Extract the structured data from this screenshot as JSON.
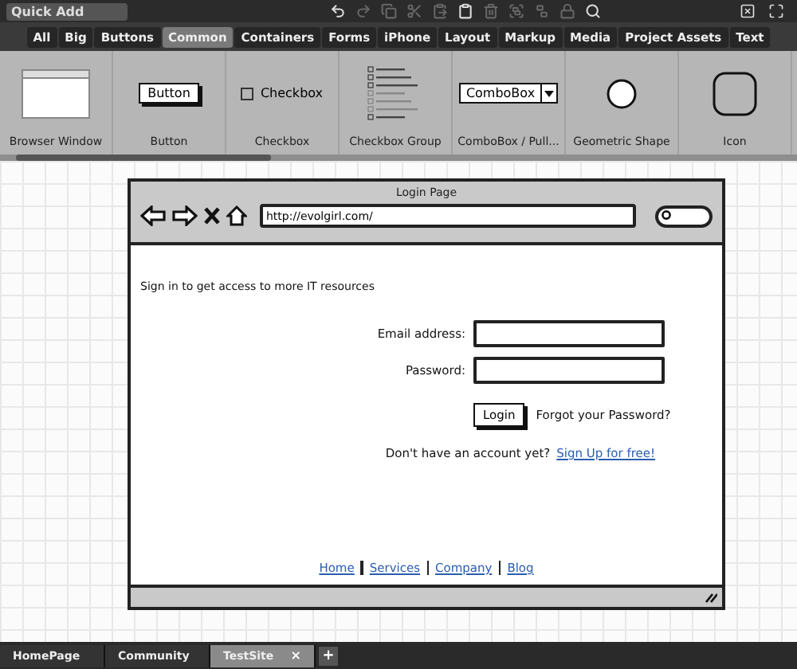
{
  "quick_add": {
    "placeholder": "Quick Add"
  },
  "toolbar": [
    {
      "kind": "undo",
      "disabled": false
    },
    {
      "kind": "redo",
      "disabled": true
    },
    {
      "kind": "copy",
      "disabled": true
    },
    {
      "kind": "cut",
      "disabled": true
    },
    {
      "kind": "paste",
      "disabled": true
    },
    {
      "kind": "clipboard",
      "disabled": false
    },
    {
      "kind": "trash",
      "disabled": true
    },
    {
      "kind": "group",
      "disabled": true
    },
    {
      "kind": "ungroup",
      "disabled": true
    },
    {
      "kind": "lock",
      "disabled": true
    },
    {
      "kind": "search",
      "disabled": false
    }
  ],
  "categories": [
    {
      "label": "All",
      "selected": false
    },
    {
      "label": "Big",
      "selected": false
    },
    {
      "label": "Buttons",
      "selected": false
    },
    {
      "label": "Common",
      "selected": true
    },
    {
      "label": "Containers",
      "selected": false
    },
    {
      "label": "Forms",
      "selected": false
    },
    {
      "label": "iPhone",
      "selected": false
    },
    {
      "label": "Layout",
      "selected": false
    },
    {
      "label": "Markup",
      "selected": false
    },
    {
      "label": "Media",
      "selected": false
    },
    {
      "label": "Project Assets",
      "selected": false
    },
    {
      "label": "Text",
      "selected": false
    }
  ],
  "palette": [
    {
      "kind": "browser",
      "label": "Browser Window"
    },
    {
      "kind": "button",
      "label": "Button",
      "preview": "Button"
    },
    {
      "kind": "checkbox",
      "label": "Checkbox",
      "preview": "Checkbox"
    },
    {
      "kind": "checkbox-group",
      "label": "Checkbox Group"
    },
    {
      "kind": "combobox",
      "label": "ComboBox / Pull...",
      "preview": "ComboBox"
    },
    {
      "kind": "shape",
      "label": "Geometric Shape"
    },
    {
      "kind": "icon",
      "label": "Icon"
    }
  ],
  "mockup": {
    "title": "Login Page",
    "url": "http://evolgirl.com/",
    "intro": "Sign in to get access to more IT resources",
    "fields": [
      {
        "label": "Email address:"
      },
      {
        "label": "Password:"
      }
    ],
    "login_button": "Login",
    "forgot": "Forgot your Password?",
    "signup_prompt": "Don't have an account yet?",
    "signup_link": "Sign Up for free!",
    "footer_links": [
      "Home",
      "Services",
      "Company",
      "Blog"
    ]
  },
  "page_tabs": [
    {
      "label": "HomePage",
      "selected": false
    },
    {
      "label": "Community",
      "selected": false
    },
    {
      "label": "TestSite",
      "selected": true,
      "close": "×"
    }
  ],
  "add_tab": "+"
}
